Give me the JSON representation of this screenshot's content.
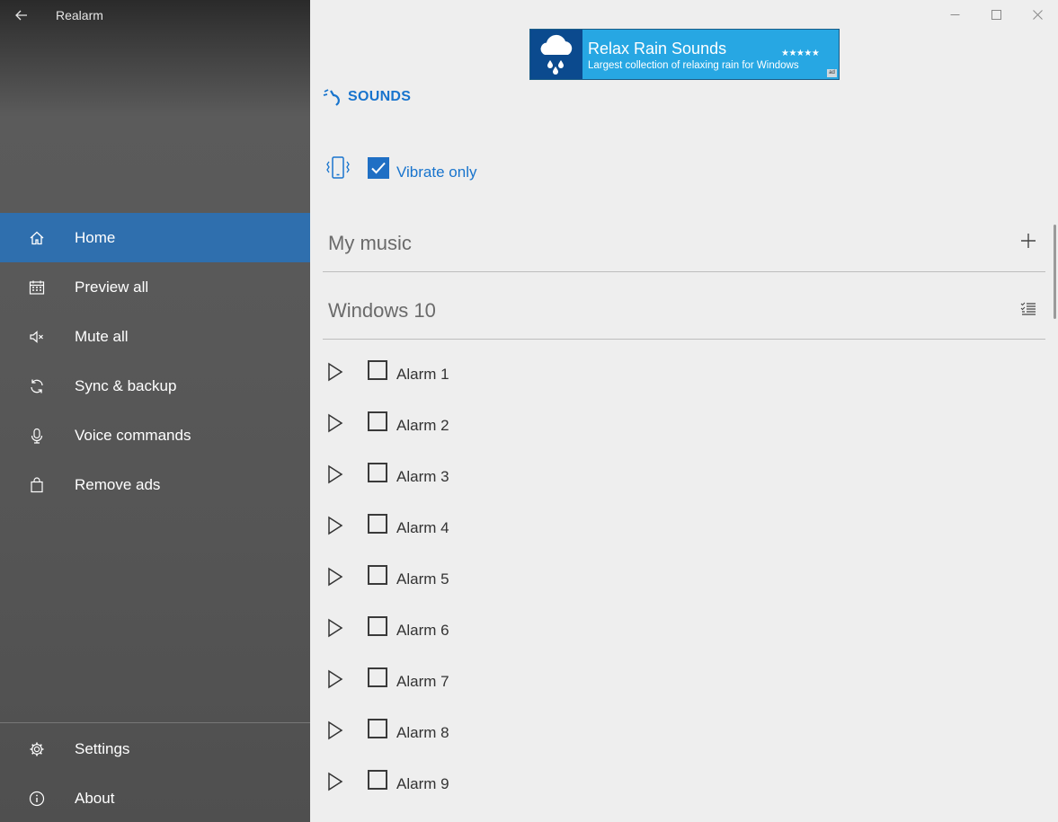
{
  "app": {
    "title": "Realarm"
  },
  "sidebar": {
    "items": [
      {
        "label": "Home",
        "icon": "home-icon",
        "active": true
      },
      {
        "label": "Preview all",
        "icon": "calendar-icon"
      },
      {
        "label": "Mute all",
        "icon": "mute-icon"
      },
      {
        "label": "Sync & backup",
        "icon": "sync-icon"
      },
      {
        "label": "Voice commands",
        "icon": "microphone-icon"
      },
      {
        "label": "Remove ads",
        "icon": "shopping-bag-icon"
      }
    ],
    "footer_items": [
      {
        "label": "Settings",
        "icon": "gear-icon"
      },
      {
        "label": "About",
        "icon": "info-icon"
      }
    ]
  },
  "ad": {
    "title": "Relax Rain Sounds",
    "subtitle": "Largest collection of relaxing rain for Windows",
    "rating_stars": "★★★★★",
    "badge": "ad"
  },
  "sounds": {
    "heading": "SOUNDS",
    "vibrate_label": "Vibrate only",
    "vibrate_checked": true,
    "sections": [
      {
        "title": "My music",
        "action": "add-icon"
      },
      {
        "title": "Windows 10",
        "action": "checklist-icon"
      }
    ],
    "alarms": [
      {
        "label": "Alarm 1",
        "checked": false
      },
      {
        "label": "Alarm 2",
        "checked": false
      },
      {
        "label": "Alarm 3",
        "checked": false
      },
      {
        "label": "Alarm 4",
        "checked": false
      },
      {
        "label": "Alarm 5",
        "checked": false
      },
      {
        "label": "Alarm 6",
        "checked": false
      },
      {
        "label": "Alarm 7",
        "checked": false
      },
      {
        "label": "Alarm 8",
        "checked": false
      },
      {
        "label": "Alarm 9",
        "checked": false
      }
    ]
  },
  "colors": {
    "accent": "#1874cd",
    "nav_active": "#2f6fae",
    "ad_background": "#27a7e3"
  }
}
